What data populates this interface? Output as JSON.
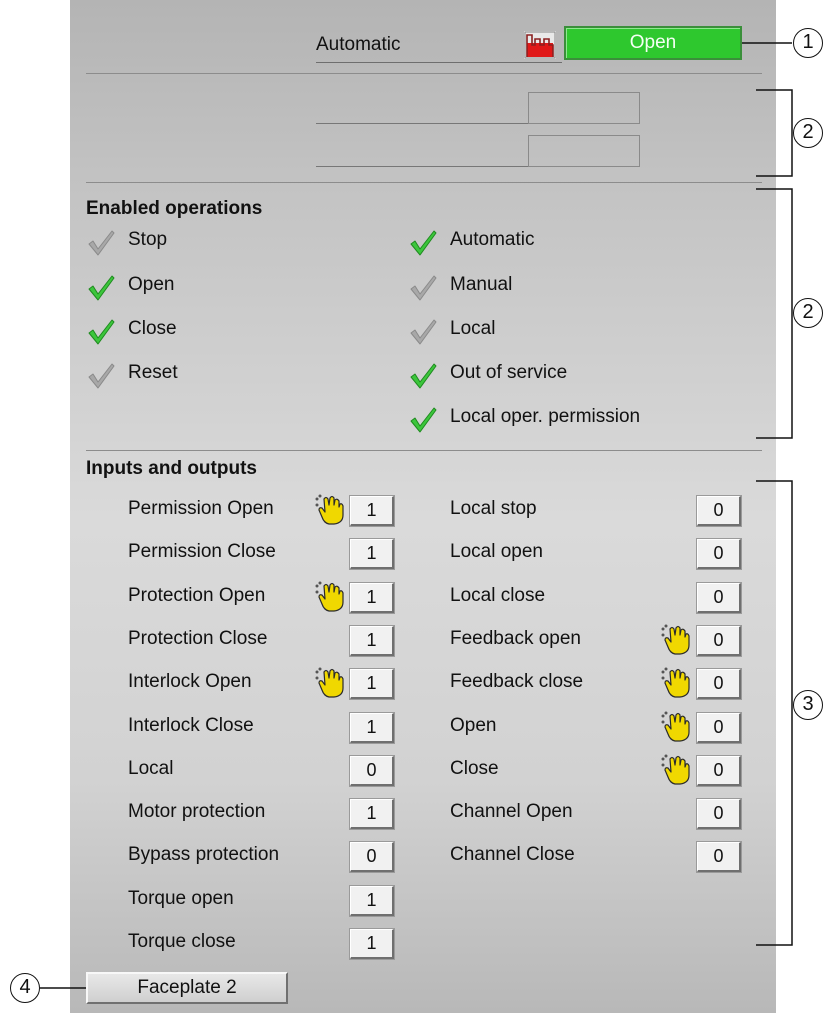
{
  "header": {
    "mode_label": "Automatic",
    "state_value": "Open",
    "state_color": "#2ec82e",
    "state_icon": "valve-state-icon"
  },
  "enabled_operations": {
    "title": "Enabled operations",
    "left": [
      {
        "label": "Stop",
        "enabled": false
      },
      {
        "label": "Open",
        "enabled": true
      },
      {
        "label": "Close",
        "enabled": true
      },
      {
        "label": "Reset",
        "enabled": false
      }
    ],
    "right": [
      {
        "label": "Automatic",
        "enabled": true
      },
      {
        "label": "Manual",
        "enabled": false
      },
      {
        "label": "Local",
        "enabled": false
      },
      {
        "label": "Out of service",
        "enabled": true
      },
      {
        "label": "Local oper. permission",
        "enabled": true
      }
    ]
  },
  "inputs_outputs": {
    "title": "Inputs and outputs",
    "left": [
      {
        "label": "Permission Open",
        "value": "1",
        "simulated": true
      },
      {
        "label": "Permission Close",
        "value": "1",
        "simulated": false
      },
      {
        "label": "Protection Open",
        "value": "1",
        "simulated": true
      },
      {
        "label": "Protection Close",
        "value": "1",
        "simulated": false
      },
      {
        "label": "Interlock Open",
        "value": "1",
        "simulated": true
      },
      {
        "label": "Interlock Close",
        "value": "1",
        "simulated": false
      },
      {
        "label": "Local",
        "value": "0",
        "simulated": false
      },
      {
        "label": "Motor protection",
        "value": "1",
        "simulated": false
      },
      {
        "label": "Bypass protection",
        "value": "0",
        "simulated": false
      },
      {
        "label": "Torque open",
        "value": "1",
        "simulated": false
      },
      {
        "label": "Torque close",
        "value": "1",
        "simulated": false
      }
    ],
    "right": [
      {
        "label": "Local stop",
        "value": "0",
        "simulated": false
      },
      {
        "label": "Local open",
        "value": "0",
        "simulated": false
      },
      {
        "label": "Local close",
        "value": "0",
        "simulated": false
      },
      {
        "label": "Feedback open",
        "value": "0",
        "simulated": true
      },
      {
        "label": "Feedback close",
        "value": "0",
        "simulated": true
      },
      {
        "label": "Open",
        "value": "0",
        "simulated": true
      },
      {
        "label": "Close",
        "value": "0",
        "simulated": true
      },
      {
        "label": "Channel Open",
        "value": "0",
        "simulated": false
      },
      {
        "label": "Channel Close",
        "value": "0",
        "simulated": false
      }
    ]
  },
  "footer": {
    "faceplate_button": "Faceplate 2"
  },
  "callouts": [
    "1",
    "2",
    "2",
    "3",
    "4"
  ],
  "colors": {
    "check_enabled": "#3cc63c",
    "check_disabled": "#a8a8a8",
    "hand_icon": "#f0d800"
  }
}
